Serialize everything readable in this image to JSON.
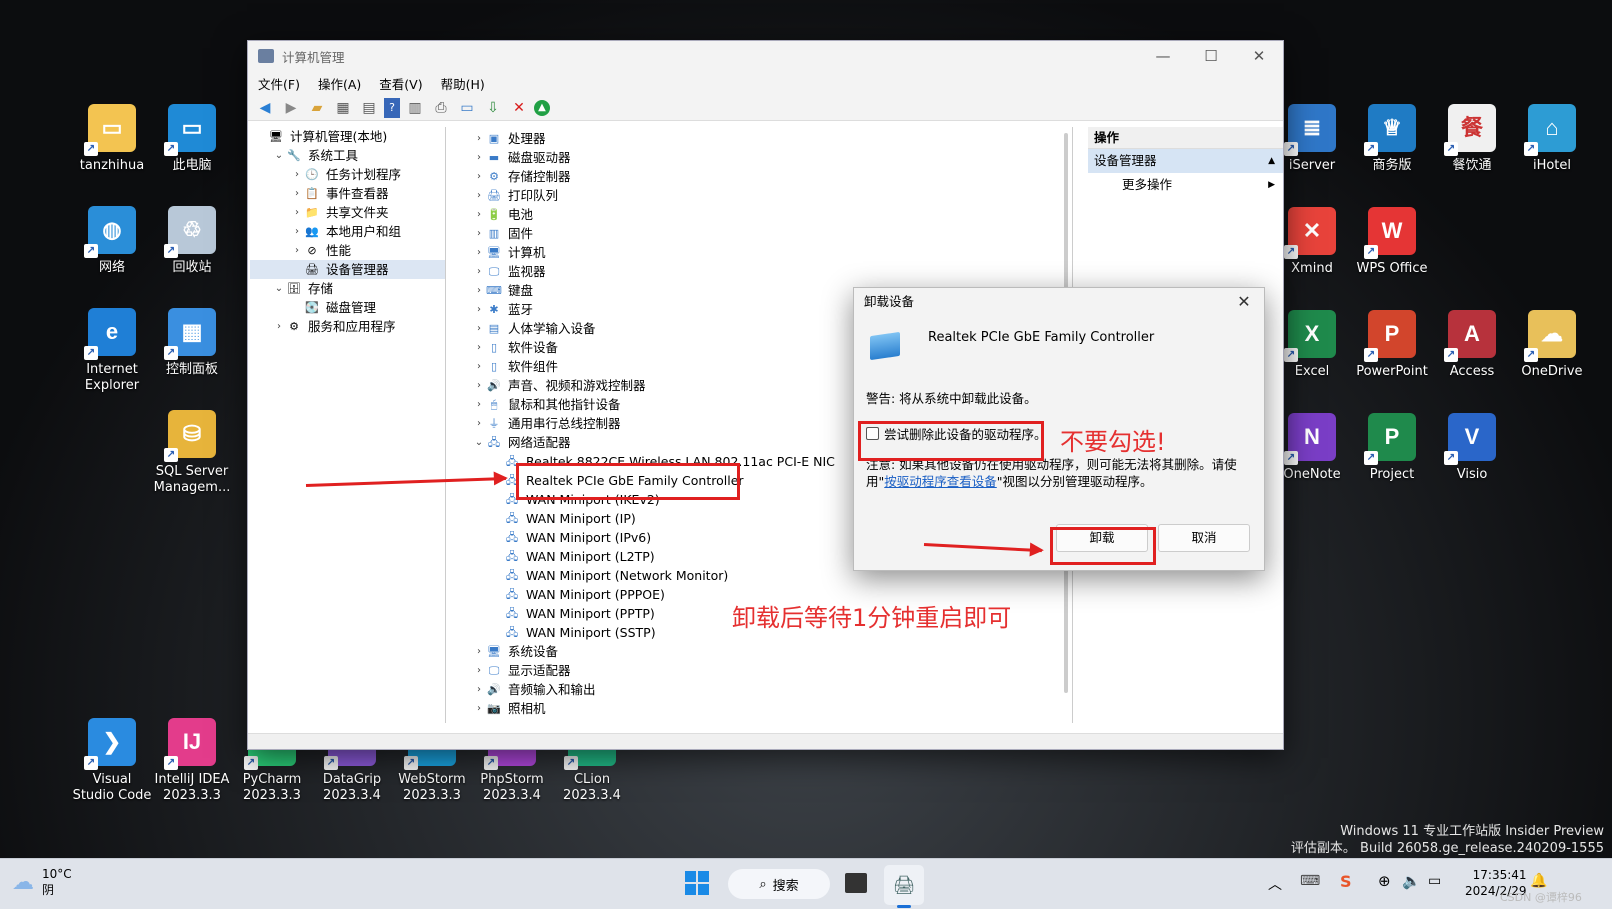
{
  "desktop": {
    "left_icons": [
      {
        "label": "tanzhihua",
        "color": "#f3c451",
        "glyph": "▭"
      },
      {
        "label": "此电脑",
        "color": "#1f8ad6",
        "glyph": "▭"
      },
      {
        "label": "网络",
        "color": "#2a8ed8",
        "glyph": "◍"
      },
      {
        "label": "回收站",
        "color": "#b8c8d8",
        "glyph": "♲"
      },
      {
        "label": "Internet\nExplorer",
        "color": "#1f7fd6",
        "glyph": "e"
      },
      {
        "label": "控制面板",
        "color": "#3a8fe0",
        "glyph": "▦"
      },
      {
        "label": "SQL Server\nManagem...",
        "color": "#e7b43b",
        "glyph": "⛁"
      }
    ],
    "bottom_icons": [
      {
        "label": "Visual\nStudio Code",
        "color": "#2a8be0",
        "glyph": "❯"
      },
      {
        "label": "IntelliJ IDEA\n2023.3.3",
        "color": "#e33c8b",
        "glyph": "IJ"
      },
      {
        "label": "PyCharm\n2023.3.3",
        "color": "#2bd17a",
        "glyph": "PC"
      },
      {
        "label": "DataGrip\n2023.3.4",
        "color": "#8f5ce0",
        "glyph": "DG"
      },
      {
        "label": "WebStorm\n2023.3.3",
        "color": "#1aa7e6",
        "glyph": "WS"
      },
      {
        "label": "PhpStorm\n2023.3.4",
        "color": "#b549e3",
        "glyph": "PS"
      },
      {
        "label": "CLion\n2023.3.4",
        "color": "#22c08a",
        "glyph": "CL"
      }
    ],
    "right_icons": [
      {
        "label": "iServer",
        "color": "#2f77c8",
        "glyph": "≣"
      },
      {
        "label": "商务版",
        "color": "#1f7bc4",
        "glyph": "♕"
      },
      {
        "label": "餐饮通",
        "color": "#f0f0f0",
        "glyph": "餐"
      },
      {
        "label": "iHotel",
        "color": "#2d9cd4",
        "glyph": "⌂"
      },
      {
        "label": "Xmind",
        "color": "#e8433b",
        "glyph": "✕"
      },
      {
        "label": "WPS Office",
        "color": "#e53535",
        "glyph": "W"
      },
      {
        "label": "",
        "color": "",
        "glyph": ""
      },
      {
        "label": "",
        "color": "",
        "glyph": ""
      },
      {
        "label": "Excel",
        "color": "#1f8a4c",
        "glyph": "X"
      },
      {
        "label": "PowerPoint",
        "color": "#d2452c",
        "glyph": "P"
      },
      {
        "label": "Access",
        "color": "#b7323c",
        "glyph": "A"
      },
      {
        "label": "OneDrive",
        "color": "#e8c05a",
        "glyph": "☁"
      },
      {
        "label": "OneNote",
        "color": "#7a3ec6",
        "glyph": "N"
      },
      {
        "label": "Project",
        "color": "#1f8a4c",
        "glyph": "P"
      },
      {
        "label": "Visio",
        "color": "#2a66c9",
        "glyph": "V"
      },
      {
        "label": "",
        "color": "",
        "glyph": ""
      }
    ]
  },
  "window": {
    "title": "计算机管理",
    "menus": [
      "文件(F)",
      "操作(A)",
      "查看(V)",
      "帮助(H)"
    ],
    "toolbar_icons": [
      "back-icon",
      "forward-icon",
      "up-folder-icon",
      "show-console-tree-icon",
      "properties-icon",
      "help-icon",
      "view-icon",
      "print-icon",
      "monitor-icon",
      "update-driver-icon",
      "uninstall-icon",
      "enable-device-icon"
    ],
    "left_tree": [
      {
        "label": "计算机管理(本地)",
        "indent": 0,
        "chev": "",
        "icon": "🖥"
      },
      {
        "label": "系统工具",
        "indent": 1,
        "chev": "⌄",
        "icon": "🔧"
      },
      {
        "label": "任务计划程序",
        "indent": 2,
        "chev": "›",
        "icon": "🕒"
      },
      {
        "label": "事件查看器",
        "indent": 2,
        "chev": "›",
        "icon": "📋"
      },
      {
        "label": "共享文件夹",
        "indent": 2,
        "chev": "›",
        "icon": "📁"
      },
      {
        "label": "本地用户和组",
        "indent": 2,
        "chev": "›",
        "icon": "👥"
      },
      {
        "label": "性能",
        "indent": 2,
        "chev": "›",
        "icon": "⊘"
      },
      {
        "label": "设备管理器",
        "indent": 2,
        "chev": "",
        "icon": "🖨",
        "selected": true
      },
      {
        "label": "存储",
        "indent": 1,
        "chev": "⌄",
        "icon": "🗄"
      },
      {
        "label": "磁盘管理",
        "indent": 2,
        "chev": "",
        "icon": "💽"
      },
      {
        "label": "服务和应用程序",
        "indent": 1,
        "chev": "›",
        "icon": "⚙"
      }
    ],
    "device_tree": [
      {
        "label": "处理器",
        "indent": 0,
        "chev": "›",
        "icon": "▣"
      },
      {
        "label": "磁盘驱动器",
        "indent": 0,
        "chev": "›",
        "icon": "▬"
      },
      {
        "label": "存储控制器",
        "indent": 0,
        "chev": "›",
        "icon": "⚙"
      },
      {
        "label": "打印队列",
        "indent": 0,
        "chev": "›",
        "icon": "🖨"
      },
      {
        "label": "电池",
        "indent": 0,
        "chev": "›",
        "icon": "🔋"
      },
      {
        "label": "固件",
        "indent": 0,
        "chev": "›",
        "icon": "▥"
      },
      {
        "label": "计算机",
        "indent": 0,
        "chev": "›",
        "icon": "🖥"
      },
      {
        "label": "监视器",
        "indent": 0,
        "chev": "›",
        "icon": "🖵"
      },
      {
        "label": "键盘",
        "indent": 0,
        "chev": "›",
        "icon": "⌨"
      },
      {
        "label": "蓝牙",
        "indent": 0,
        "chev": "›",
        "icon": "✱"
      },
      {
        "label": "人体学输入设备",
        "indent": 0,
        "chev": "›",
        "icon": "▤"
      },
      {
        "label": "软件设备",
        "indent": 0,
        "chev": "›",
        "icon": "▯"
      },
      {
        "label": "软件组件",
        "indent": 0,
        "chev": "›",
        "icon": "▯"
      },
      {
        "label": "声音、视频和游戏控制器",
        "indent": 0,
        "chev": "›",
        "icon": "🔊"
      },
      {
        "label": "鼠标和其他指针设备",
        "indent": 0,
        "chev": "›",
        "icon": "🖱"
      },
      {
        "label": "通用串行总线控制器",
        "indent": 0,
        "chev": "›",
        "icon": "⏚"
      },
      {
        "label": "网络适配器",
        "indent": 0,
        "chev": "⌄",
        "icon": "🖧"
      },
      {
        "label": "Realtek 8822CE Wireless LAN 802.11ac PCI-E NIC",
        "indent": 1,
        "chev": "",
        "icon": "🖧"
      },
      {
        "label": "Realtek PCIe GbE Family Controller",
        "indent": 1,
        "chev": "",
        "icon": "🖧"
      },
      {
        "label": "WAN Miniport (IKEv2)",
        "indent": 1,
        "chev": "",
        "icon": "🖧"
      },
      {
        "label": "WAN Miniport (IP)",
        "indent": 1,
        "chev": "",
        "icon": "🖧"
      },
      {
        "label": "WAN Miniport (IPv6)",
        "indent": 1,
        "chev": "",
        "icon": "🖧"
      },
      {
        "label": "WAN Miniport (L2TP)",
        "indent": 1,
        "chev": "",
        "icon": "🖧"
      },
      {
        "label": "WAN Miniport (Network Monitor)",
        "indent": 1,
        "chev": "",
        "icon": "🖧"
      },
      {
        "label": "WAN Miniport (PPPOE)",
        "indent": 1,
        "chev": "",
        "icon": "🖧"
      },
      {
        "label": "WAN Miniport (PPTP)",
        "indent": 1,
        "chev": "",
        "icon": "🖧"
      },
      {
        "label": "WAN Miniport (SSTP)",
        "indent": 1,
        "chev": "",
        "icon": "🖧"
      },
      {
        "label": "系统设备",
        "indent": 0,
        "chev": "›",
        "icon": "🖥"
      },
      {
        "label": "显示适配器",
        "indent": 0,
        "chev": "›",
        "icon": "🖵"
      },
      {
        "label": "音频输入和输出",
        "indent": 0,
        "chev": "›",
        "icon": "🔊"
      },
      {
        "label": "照相机",
        "indent": 0,
        "chev": "›",
        "icon": "📷"
      }
    ],
    "actions": {
      "header": "操作",
      "section": "设备管理器",
      "more": "更多操作"
    }
  },
  "dialog": {
    "title": "卸载设备",
    "device_name": "Realtek PCIe GbE Family Controller",
    "warning": "警告: 将从系统中卸载此设备。",
    "checkbox_label": "尝试删除此设备的驱动程序。",
    "note_prefix": "注意: 如果其他设备仍在使用驱动程序，则可能无法将其删除。请使用\"",
    "note_link": "按驱动程序查看设备",
    "note_suffix": "\"视图以分别管理驱动程序。",
    "uninstall_button": "卸载",
    "cancel_button": "取消"
  },
  "annotations": {
    "no_check": "不要勾选!",
    "restart_tip": "卸载后等待1分钟重启即可",
    "color": "#e53030"
  },
  "watermark": {
    "line1": "Windows 11 专业工作站版 Insider Preview",
    "line2": "评估副本。 Build 26058.ge_release.240209-1555"
  },
  "taskbar": {
    "weather_temp": "10°C",
    "weather_cond": "阴",
    "search_label": "搜索",
    "time": "17:35:41",
    "date": "2024/2/29",
    "credit": "CSDN @谭梓96"
  }
}
